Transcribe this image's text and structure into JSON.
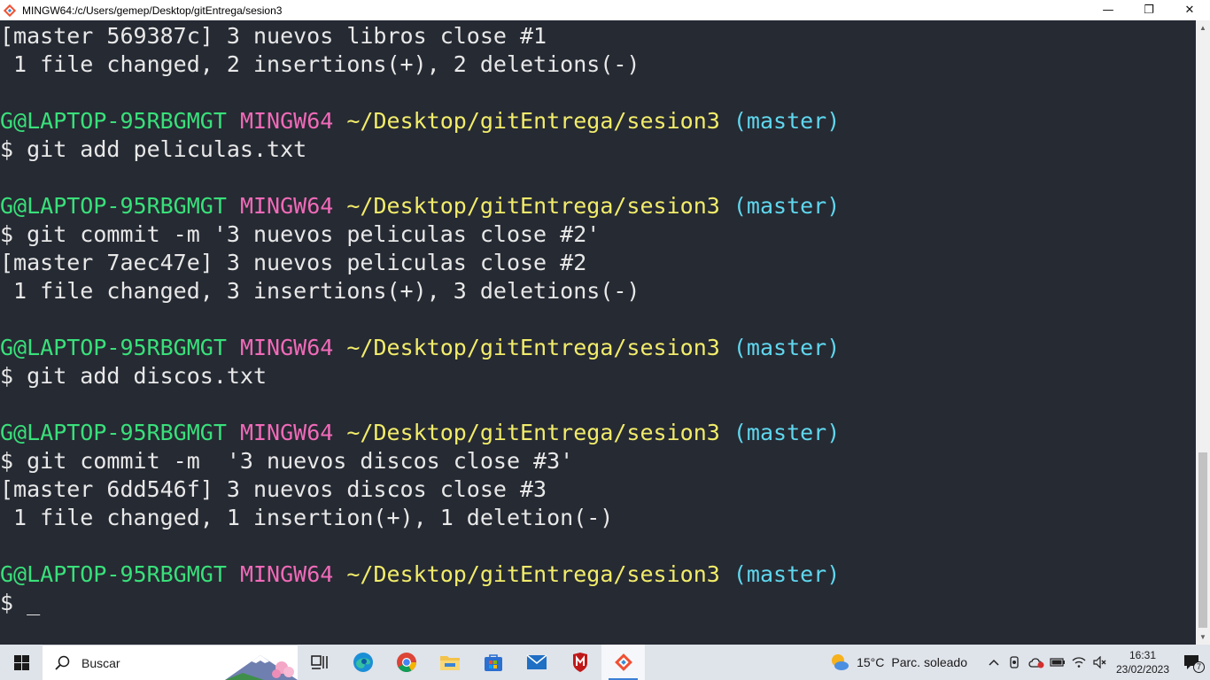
{
  "window": {
    "title": "MINGW64:/c/Users/gemep/Desktop/gitEntrega/sesion3",
    "controls": {
      "minimize": "—",
      "maximize": "❐",
      "close": "✕"
    }
  },
  "terminal": {
    "lines": [
      {
        "type": "out",
        "text": "[master 569387c] 3 nuevos libros close #1"
      },
      {
        "type": "out",
        "text": " 1 file changed, 2 insertions(+), 2 deletions(-)"
      },
      {
        "type": "blank",
        "text": ""
      },
      {
        "type": "prompt",
        "user": "G@LAPTOP-95RBGMGT",
        "host": "MINGW64",
        "path": "~/Desktop/gitEntrega/sesion3",
        "branch": "(master)"
      },
      {
        "type": "out",
        "text": "$ git add peliculas.txt"
      },
      {
        "type": "blank",
        "text": ""
      },
      {
        "type": "prompt",
        "user": "G@LAPTOP-95RBGMGT",
        "host": "MINGW64",
        "path": "~/Desktop/gitEntrega/sesion3",
        "branch": "(master)"
      },
      {
        "type": "out",
        "text": "$ git commit -m '3 nuevos peliculas close #2'"
      },
      {
        "type": "out",
        "text": "[master 7aec47e] 3 nuevos peliculas close #2"
      },
      {
        "type": "out",
        "text": " 1 file changed, 3 insertions(+), 3 deletions(-)"
      },
      {
        "type": "blank",
        "text": ""
      },
      {
        "type": "prompt",
        "user": "G@LAPTOP-95RBGMGT",
        "host": "MINGW64",
        "path": "~/Desktop/gitEntrega/sesion3",
        "branch": "(master)"
      },
      {
        "type": "out",
        "text": "$ git add discos.txt"
      },
      {
        "type": "blank",
        "text": ""
      },
      {
        "type": "prompt",
        "user": "G@LAPTOP-95RBGMGT",
        "host": "MINGW64",
        "path": "~/Desktop/gitEntrega/sesion3",
        "branch": "(master)"
      },
      {
        "type": "out",
        "text": "$ git commit -m  '3 nuevos discos close #3'"
      },
      {
        "type": "out",
        "text": "[master 6dd546f] 3 nuevos discos close #3"
      },
      {
        "type": "out",
        "text": " 1 file changed, 1 insertion(+), 1 deletion(-)"
      },
      {
        "type": "blank",
        "text": ""
      },
      {
        "type": "prompt",
        "user": "G@LAPTOP-95RBGMGT",
        "host": "MINGW64",
        "path": "~/Desktop/gitEntrega/sesion3",
        "branch": "(master)"
      },
      {
        "type": "input",
        "text": "$ ",
        "cursor": "_"
      }
    ],
    "colors": {
      "background": "#262a33",
      "text": "#e8e8e8",
      "user": "#39e07a",
      "host": "#f06ab8",
      "path": "#f2ec6a",
      "branch": "#5fd7ee"
    }
  },
  "taskbar": {
    "search_placeholder": "Buscar",
    "apps": [
      {
        "name": "task-view-icon"
      },
      {
        "name": "edge-icon"
      },
      {
        "name": "chrome-icon"
      },
      {
        "name": "file-explorer-icon"
      },
      {
        "name": "microsoft-store-icon"
      },
      {
        "name": "mail-icon"
      },
      {
        "name": "mcafee-icon"
      },
      {
        "name": "git-bash-icon",
        "active": true
      }
    ],
    "weather": {
      "temp": "15°C",
      "desc": "Parc. soleado"
    },
    "clock": {
      "time": "16:31",
      "date": "23/02/2023"
    },
    "notifications_count": "7"
  }
}
